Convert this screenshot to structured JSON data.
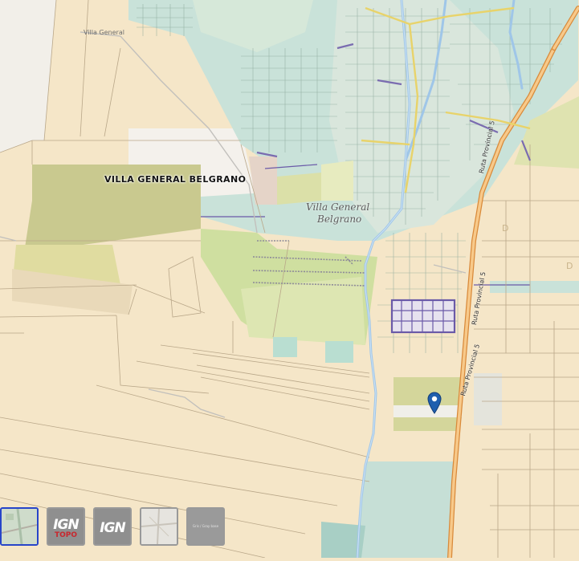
{
  "map": {
    "place_label": "VILLA GENERAL BELGRANO",
    "town_label_line1": "Villa General",
    "town_label_line2": "Belgrano",
    "small_label_top": "Villa General",
    "road_labels": [
      "Ruta Provincial 5",
      "Ruta Provincial 5",
      "Ruta Provincial 5"
    ],
    "road_letters": [
      "D",
      "D"
    ],
    "marker": {
      "icon": "map-pin-icon",
      "color": "#1f5fae"
    }
  },
  "layers": [
    {
      "name": "satellite",
      "label": "",
      "active": true
    },
    {
      "name": "ign-topo",
      "label": "IGN",
      "sublabel": "TOPO",
      "active": false
    },
    {
      "name": "ign",
      "label": "IGN",
      "active": false
    },
    {
      "name": "street-light",
      "label": "",
      "active": false
    },
    {
      "name": "gray",
      "label": "Gris / Gray base",
      "active": false
    }
  ],
  "colors": {
    "land": "#f5e6c8",
    "field_green": "#cdd9a4",
    "urban_teal": "#a9d7cf",
    "road_orange": "#f2a65a",
    "water": "#9fc6e8",
    "parcel_line": "#b9a789"
  }
}
